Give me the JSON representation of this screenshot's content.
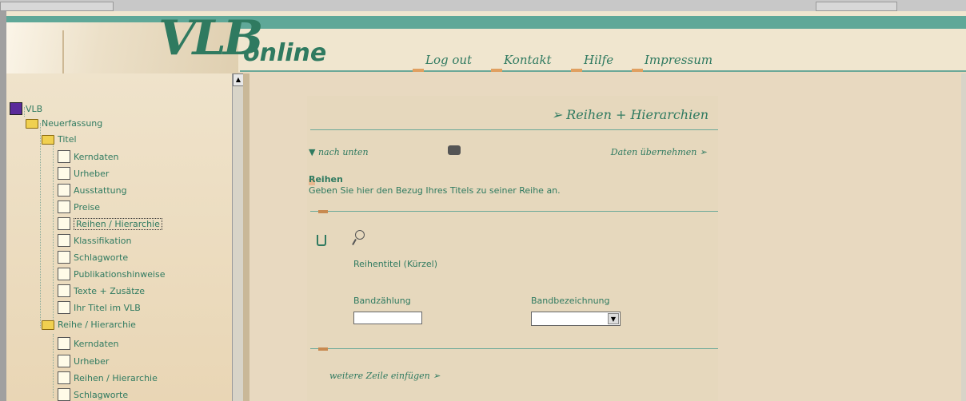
{
  "header": {
    "logo_main": "VLB",
    "logo_sub": "online",
    "nav": [
      "Log out",
      "Kontakt",
      "Hilfe",
      "Impressum"
    ]
  },
  "tree": [
    {
      "label": "VLB",
      "icon": "book-icon"
    },
    {
      "label": "Neuerfassung",
      "icon": "folder-icon"
    },
    {
      "label": "Titel",
      "icon": "folder-icon"
    },
    {
      "label": "Kerndaten",
      "icon": "document-icon"
    },
    {
      "label": "Urheber",
      "icon": "document-icon"
    },
    {
      "label": "Ausstattung",
      "icon": "document-icon"
    },
    {
      "label": "Preise",
      "icon": "document-icon"
    },
    {
      "label": "Reihen / Hierarchie",
      "icon": "document-icon"
    },
    {
      "label": "Klassifikation",
      "icon": "document-icon"
    },
    {
      "label": "Schlagworte",
      "icon": "document-icon"
    },
    {
      "label": "Publikationshinweise",
      "icon": "document-icon"
    },
    {
      "label": "Texte + Zusätze",
      "icon": "document-icon"
    },
    {
      "label": "Ihr Titel im VLB",
      "icon": "document-icon"
    },
    {
      "label": "Reihe / Hierarchie",
      "icon": "folder-icon"
    },
    {
      "label": "Kerndaten",
      "icon": "document-icon"
    },
    {
      "label": "Urheber",
      "icon": "document-icon"
    },
    {
      "label": "Reihen / Hierarchie",
      "icon": "document-icon"
    },
    {
      "label": "Schlagworte",
      "icon": "document-icon"
    }
  ],
  "main": {
    "title": "➢ Reihen + Hierarchien",
    "nach_unten": "▼ nach unten",
    "daten_uebernehmen": "Daten übernehmen ➢",
    "section_heading": "Reihen",
    "section_text": "Geben Sie hier den Bezug Ihres Titels zu seiner Reihe an.",
    "reihentitel_label": "Reihentitel (Kürzel)",
    "bandzaehlung_label": "Bandzählung",
    "bandzaehlung_value": "",
    "bandbezeichnung_label": "Bandbezeichnung",
    "bandbezeichnung_value": "",
    "weitere_zeile": "weitere Zeile einfügen ➢"
  },
  "colors": {
    "accent": "#2f7a60",
    "background": "#e8d9c0",
    "stripe": "#5fa898"
  }
}
